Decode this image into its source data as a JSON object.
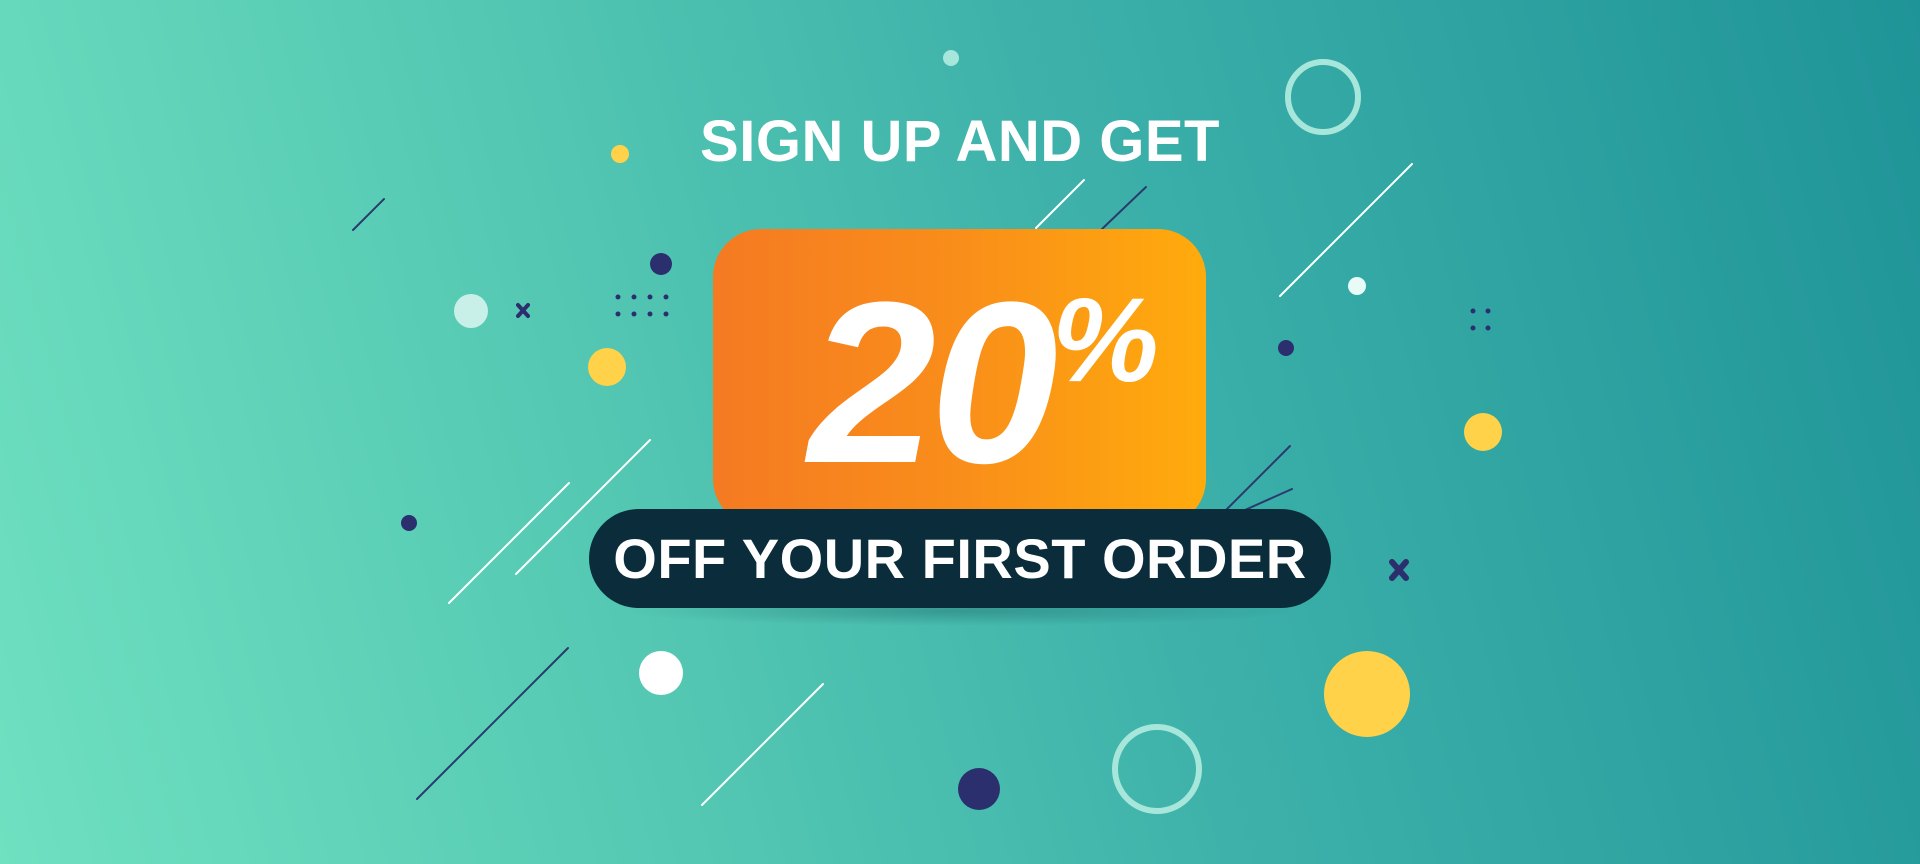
{
  "banner": {
    "headline": "SIGN UP AND GET",
    "discount_value": "20",
    "discount_symbol": "%",
    "tagline": "OFF YOUR FIRST ORDER"
  },
  "colors": {
    "background_start": "#6fe0c0",
    "background_end": "#1f9498",
    "box_start": "#f57a22",
    "box_end": "#ffab0c",
    "pill": "#0b2c3a",
    "yellow_accent": "#ffd24a",
    "navy_accent": "#2b2f6e"
  },
  "icons": [
    "circle-ring-icon",
    "dot-icon",
    "cross-icon",
    "dot-grid-icon",
    "diagonal-line-icon"
  ]
}
